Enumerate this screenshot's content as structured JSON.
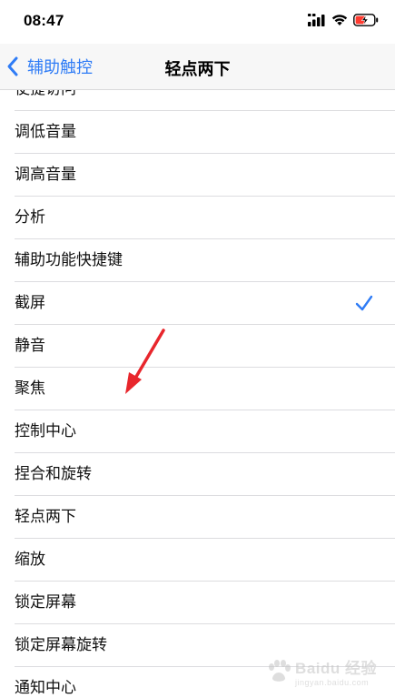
{
  "status_bar": {
    "time": "08:47",
    "icons": [
      "cellular-signal-icon",
      "wifi-icon",
      "battery-charging-icon"
    ],
    "battery_color": "#ff3b30"
  },
  "nav": {
    "back_label": "辅助触控",
    "title": "轻点两下",
    "accent_color": "#2f7cf6"
  },
  "list": {
    "items": [
      {
        "label": "使捷访问",
        "checked": false
      },
      {
        "label": "调低音量",
        "checked": false
      },
      {
        "label": "调高音量",
        "checked": false
      },
      {
        "label": "分析",
        "checked": false
      },
      {
        "label": "辅助功能快捷键",
        "checked": false
      },
      {
        "label": "截屏",
        "checked": true
      },
      {
        "label": "静音",
        "checked": false
      },
      {
        "label": "聚焦",
        "checked": false
      },
      {
        "label": "控制中心",
        "checked": false
      },
      {
        "label": "捏合和旋转",
        "checked": false
      },
      {
        "label": "轻点两下",
        "checked": false
      },
      {
        "label": "缩放",
        "checked": false
      },
      {
        "label": "锁定屏幕",
        "checked": false
      },
      {
        "label": "锁定屏幕旋转",
        "checked": false
      },
      {
        "label": "通知中心",
        "checked": false
      }
    ]
  },
  "annotation": {
    "arrow_color": "#e8262c"
  },
  "watermark": {
    "title": "Baidu 经验",
    "subtitle": "jingyan.baidu.com"
  }
}
